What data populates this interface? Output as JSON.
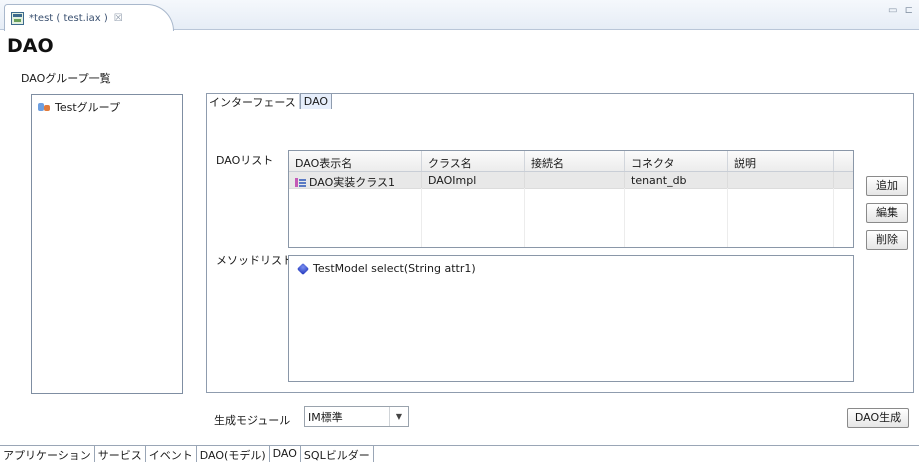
{
  "editor_tab": {
    "title": "*test ( test.iax ) ",
    "close": "☒"
  },
  "window_controls": "▭ ⊏",
  "page_title": "DAO",
  "group_caption": "DAOグループ一覧",
  "groups": [
    {
      "label": "Testグループ",
      "icon": "group-icon"
    }
  ],
  "inner_tabs": [
    "インターフェース",
    "DAO"
  ],
  "dao_list": {
    "label": "DAOリスト",
    "columns": [
      "DAO表示名",
      "クラス名",
      "接続名",
      "コネクタ",
      "説明"
    ],
    "rows": [
      {
        "display_name": "DAO実装クラス1",
        "class_name": "DAOImpl",
        "connection": "",
        "connector": "tenant_db",
        "description": ""
      }
    ]
  },
  "buttons": {
    "add": "追加",
    "edit": "編集",
    "delete": "削除",
    "generate": "DAO生成"
  },
  "method_list": {
    "label": "メソッドリスト",
    "items": [
      "TestModel select(String attr1)"
    ]
  },
  "generation_module": {
    "label": "生成モジュール",
    "value": "IM標準",
    "arrow": "▼"
  },
  "bottom_tabs": [
    "アプリケーション",
    "サービス",
    "イベント",
    "DAO(モデル)",
    "DAO",
    "SQLビルダー"
  ],
  "colors": {
    "tab_strip": "#e6edf6",
    "selected_row": "#e8e8e8",
    "border": "#8a97a8"
  }
}
